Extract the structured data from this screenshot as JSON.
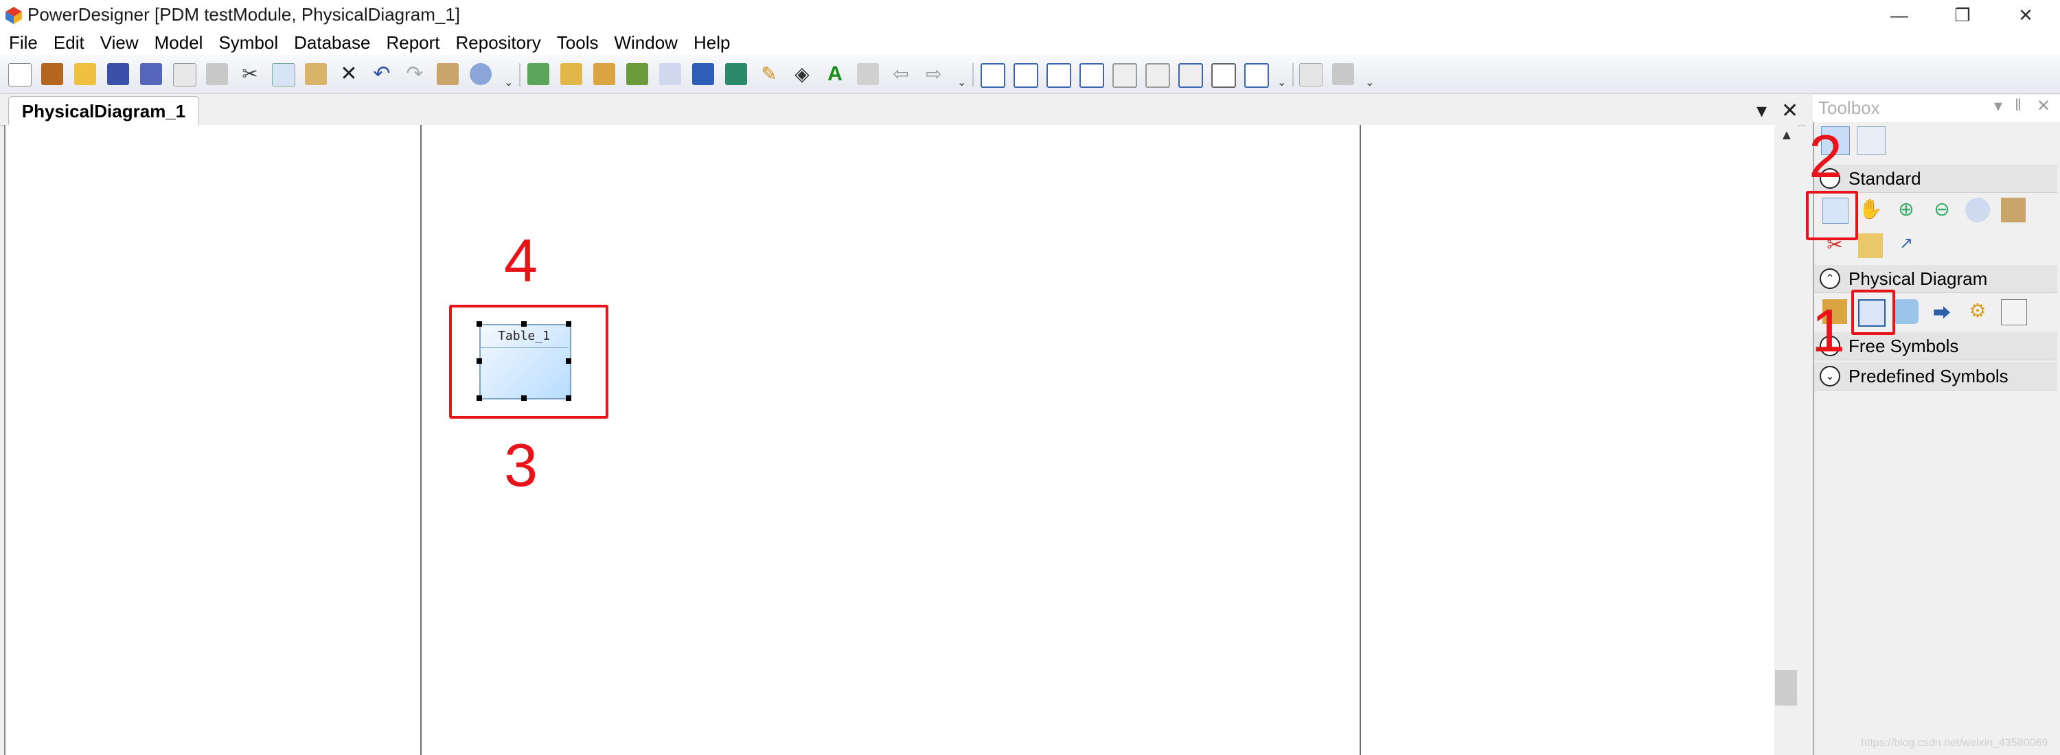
{
  "window": {
    "title": "PowerDesigner [PDM testModule, PhysicalDiagram_1]"
  },
  "menu": [
    "File",
    "Edit",
    "View",
    "Model",
    "Symbol",
    "Database",
    "Report",
    "Repository",
    "Tools",
    "Window",
    "Help"
  ],
  "document_tab": {
    "label": "PhysicalDiagram_1"
  },
  "diagram": {
    "table_name": "Table_1"
  },
  "toolbox": {
    "title": "Toolbox",
    "sections": [
      {
        "label": "Standard",
        "state": "expanded"
      },
      {
        "label": "Physical Diagram",
        "state": "expanded"
      },
      {
        "label": "Free Symbols",
        "state": "collapsed"
      },
      {
        "label": "Predefined Symbols",
        "state": "collapsed"
      }
    ]
  },
  "annotations": {
    "n1": "1",
    "n2": "2",
    "n3": "3",
    "n4": "4"
  },
  "watermark": "https://blog.csdn.net/weixin_43580069",
  "colors": {
    "annotation_red": "#e8141a",
    "table_fill": "#b8dcff"
  }
}
